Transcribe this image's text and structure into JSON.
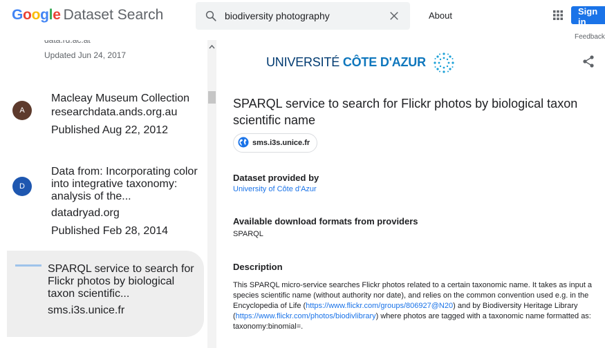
{
  "header": {
    "logo_brand": [
      "G",
      "o",
      "o",
      "g",
      "l",
      "e"
    ],
    "logo_product": "Dataset Search",
    "search_value": "biodiversity photography",
    "about_label": "About",
    "signin_label": "Sign in",
    "feedback_label": "Feedback"
  },
  "results": [
    {
      "source": "data.rd.ac.at",
      "date": "Updated Jun 24, 2017"
    },
    {
      "avatar": "A",
      "avatar_color": "#5d3a2c",
      "title": "Macleay Museum Collection",
      "source": "researchdata.ands.org.au",
      "date": "Published Aug 22, 2012"
    },
    {
      "avatar": "D",
      "avatar_color": "#1e57b0",
      "title": "Data from: Incorporating color into integrative taxonomy: analysis of the...",
      "source": "datadryad.org",
      "date": "Published Feb 28, 2014"
    },
    {
      "title": "SPARQL service to search for Flickr photos by biological taxon scientific...",
      "source": "sms.i3s.unice.fr",
      "selected": true
    }
  ],
  "detail": {
    "logo_text_light": "UNIVERSITÉ ",
    "logo_text_bold": "CÔTE D'AZUR",
    "title": "SPARQL service to search for Flickr photos by biological taxon scientific name",
    "chip_label": "sms.i3s.unice.fr",
    "provided_heading": "Dataset provided by",
    "provider": "University of Côte d'Azur",
    "formats_heading": "Available download formats from providers",
    "format": "SPARQL",
    "description_heading": "Description",
    "description_parts": [
      "This SPARQL micro-service searches Flickr photos related to a certain taxonomic name. It takes as input a species scientific name (without authority nor date), and relies on the common convention used e.g. in the Encyclopedia of Life (",
      "https://www.flickr.com/groups/806927@N20",
      ") and by Biodiversity Heritage Library (",
      "https://www.flickr.com/photos/biodivlibrary",
      ") where photos are tagged with a taxonomic name formatted as: taxonomy:binomial=."
    ]
  },
  "colors": {
    "accent": "#1a73e8",
    "selected_bg": "#eeeeee"
  }
}
